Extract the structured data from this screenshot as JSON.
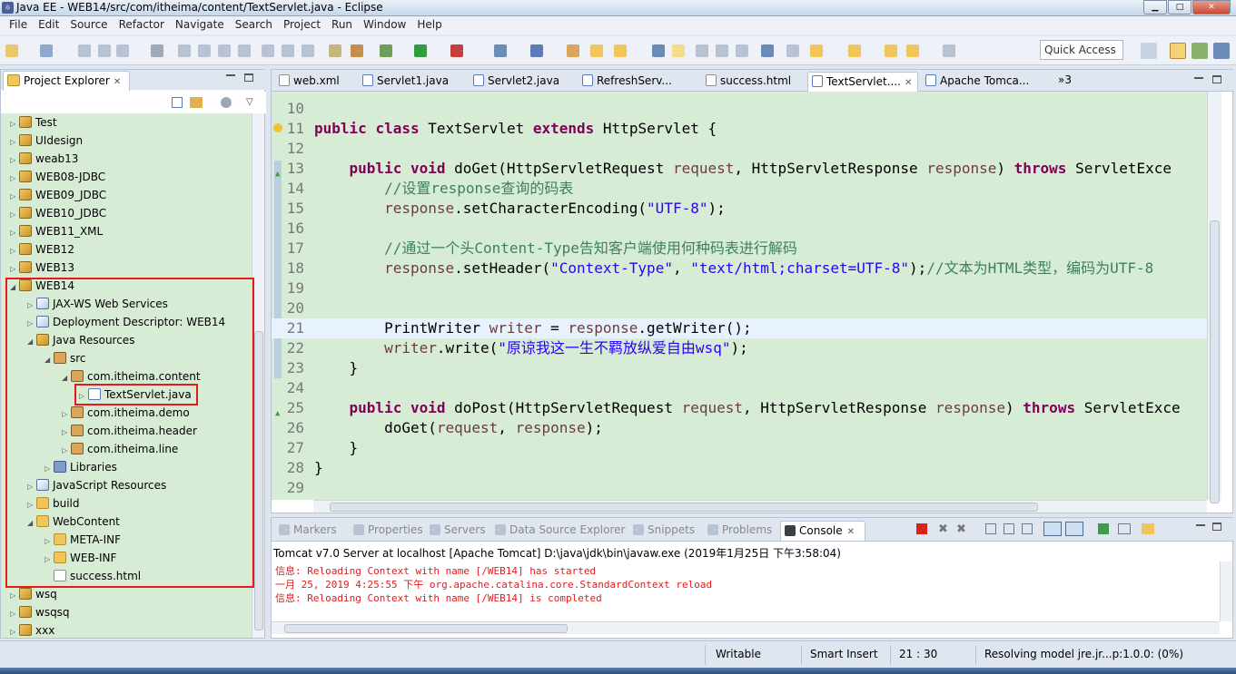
{
  "window": {
    "title": "Java EE - WEB14/src/com/itheima/content/TextServlet.java - Eclipse",
    "minimize": "▁",
    "maximize": "□",
    "close": "✕"
  },
  "menu": [
    "File",
    "Edit",
    "Source",
    "Refactor",
    "Navigate",
    "Search",
    "Project",
    "Run",
    "Window",
    "Help"
  ],
  "quick_access": "Quick Access",
  "explorer": {
    "tab_label": "Project Explorer",
    "close_glyph": "✕",
    "items": [
      {
        "label": "Test",
        "type": "proj",
        "expanded": false
      },
      {
        "label": "UIdesign",
        "type": "proj",
        "expanded": false
      },
      {
        "label": "weab13",
        "type": "proj",
        "expanded": false
      },
      {
        "label": "WEB08-JDBC",
        "type": "proj",
        "expanded": false
      },
      {
        "label": "WEB09_JDBC",
        "type": "proj",
        "expanded": false
      },
      {
        "label": "WEB10_JDBC",
        "type": "proj",
        "expanded": false
      },
      {
        "label": "WEB11_XML",
        "type": "proj",
        "expanded": false
      },
      {
        "label": "WEB12",
        "type": "proj",
        "expanded": false
      },
      {
        "label": "WEB13",
        "type": "proj",
        "expanded": false
      },
      {
        "label": "WEB14",
        "type": "proj",
        "expanded": true
      },
      {
        "label": "JAX-WS Web Services",
        "type": "web",
        "expanded": false
      },
      {
        "label": "Deployment Descriptor: WEB14",
        "type": "web",
        "expanded": false
      },
      {
        "label": "Java Resources",
        "type": "proj",
        "expanded": true
      },
      {
        "label": "src",
        "type": "pkg",
        "expanded": true
      },
      {
        "label": "com.itheima.content",
        "type": "pkg",
        "expanded": true
      },
      {
        "label": "TextServlet.java",
        "type": "java",
        "expanded": false
      },
      {
        "label": "com.itheima.demo",
        "type": "pkg",
        "expanded": false
      },
      {
        "label": "com.itheima.header",
        "type": "pkg",
        "expanded": false
      },
      {
        "label": "com.itheima.line",
        "type": "pkg",
        "expanded": false
      },
      {
        "label": "Libraries",
        "type": "lib",
        "expanded": false
      },
      {
        "label": "JavaScript Resources",
        "type": "web",
        "expanded": false
      },
      {
        "label": "build",
        "type": "folder",
        "expanded": false
      },
      {
        "label": "WebContent",
        "type": "folder",
        "expanded": true
      },
      {
        "label": "META-INF",
        "type": "folder",
        "expanded": false
      },
      {
        "label": "WEB-INF",
        "type": "folder",
        "expanded": false
      },
      {
        "label": "success.html",
        "type": "html",
        "expanded": null
      },
      {
        "label": "wsq",
        "type": "proj",
        "expanded": false
      },
      {
        "label": "wsqsq",
        "type": "proj",
        "expanded": false
      },
      {
        "label": "xxx",
        "type": "proj",
        "expanded": false
      }
    ]
  },
  "editor": {
    "tabs": [
      {
        "label": "web.xml",
        "active": false
      },
      {
        "label": "Servlet1.java",
        "active": false
      },
      {
        "label": "Servlet2.java",
        "active": false
      },
      {
        "label": "RefreshServ...",
        "active": false
      },
      {
        "label": "success.html",
        "active": false
      },
      {
        "label": "TextServlet....",
        "active": true
      },
      {
        "label": "Apache Tomca...",
        "active": false
      }
    ],
    "overflow": "»3",
    "lines": [
      {
        "n": "10",
        "code": ""
      },
      {
        "n": "11",
        "code": "public class TextServlet extends HttpServlet {"
      },
      {
        "n": "12",
        "code": ""
      },
      {
        "n": "13",
        "code": "    public void doGet(HttpServletRequest request, HttpServletResponse response) throws ServletExce"
      },
      {
        "n": "14",
        "code": "        //设置response查询的码表"
      },
      {
        "n": "15",
        "code": "        response.setCharacterEncoding(\"UTF-8\");"
      },
      {
        "n": "16",
        "code": ""
      },
      {
        "n": "17",
        "code": "        //通过一个头Content-Type告知客户端使用何种码表进行解码"
      },
      {
        "n": "18",
        "code": "        response.setHeader(\"Context-Type\", \"text/html;charset=UTF-8\");//文本为HTML类型，编码为UTF-8"
      },
      {
        "n": "19",
        "code": ""
      },
      {
        "n": "20",
        "code": ""
      },
      {
        "n": "21",
        "code": "        PrintWriter writer = response.getWriter();"
      },
      {
        "n": "22",
        "code": "        writer.write(\"原谅我这一生不羁放纵爱自由wsq\");"
      },
      {
        "n": "23",
        "code": "    }"
      },
      {
        "n": "24",
        "code": ""
      },
      {
        "n": "25",
        "code": "    public void doPost(HttpServletRequest request, HttpServletResponse response) throws ServletExce"
      },
      {
        "n": "26",
        "code": "        doGet(request, response);"
      },
      {
        "n": "27",
        "code": "    }"
      },
      {
        "n": "28",
        "code": "}"
      },
      {
        "n": "29",
        "code": ""
      }
    ]
  },
  "console": {
    "tabs": [
      {
        "label": "Markers",
        "active": false
      },
      {
        "label": "Properties",
        "active": false
      },
      {
        "label": "Servers",
        "active": false
      },
      {
        "label": "Data Source Explorer",
        "active": false
      },
      {
        "label": "Snippets",
        "active": false
      },
      {
        "label": "Problems",
        "active": false
      },
      {
        "label": "Console",
        "active": true
      }
    ],
    "header": "Tomcat v7.0 Server at localhost [Apache Tomcat] D:\\java\\jdk\\bin\\javaw.exe (2019年1月25日 下午3:58:04)",
    "lines": [
      "信息: Reloading Context with name [/WEB14] has started",
      "一月 25, 2019 4:25:55 下午 org.apache.catalina.core.StandardContext reload",
      "信息: Reloading Context with name [/WEB14] is completed"
    ]
  },
  "status": {
    "writable": "Writable",
    "insert": "Smart Insert",
    "position": "21 : 30",
    "task": "Resolving model jre.jr...p:1.0.0: (0%)"
  }
}
